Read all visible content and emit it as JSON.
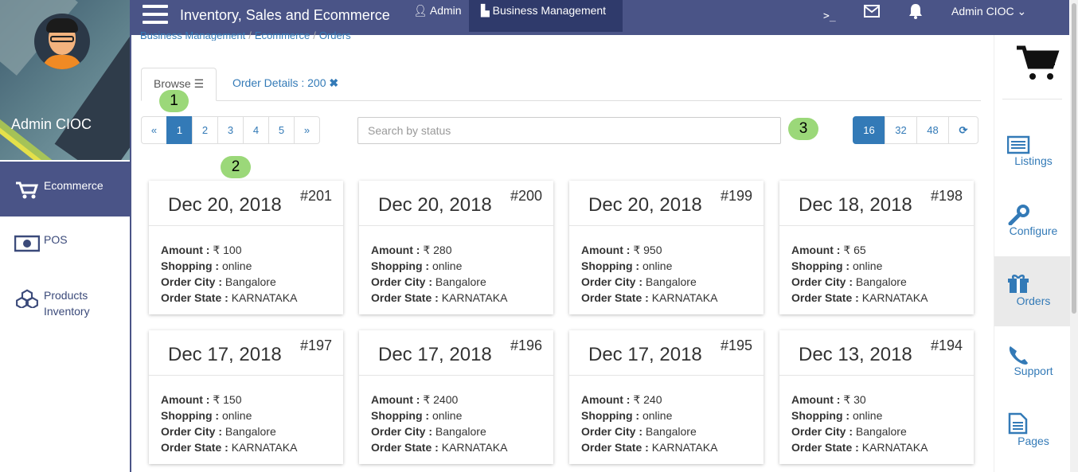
{
  "app": {
    "title": "Inventory, Sales and Ecommerce"
  },
  "topnav": {
    "admin_label": "Admin",
    "business_label": "Business Management",
    "terminal": ">_",
    "user_label": "Admin CIOC"
  },
  "profile": {
    "name": "Admin CIOC"
  },
  "sidebar": {
    "items": [
      {
        "label": "Ecommerce",
        "icon": "cart-icon",
        "active": true
      },
      {
        "label": "POS",
        "icon": "money-icon",
        "active": false
      },
      {
        "label": "Products Inventory",
        "icon": "cubes-icon",
        "active": false
      }
    ]
  },
  "breadcrumb": [
    "Business Management",
    "Ecommerce",
    "Orders"
  ],
  "tabs": {
    "browse_label": "Browse",
    "order_details_label": "Order Details : 200"
  },
  "annotations": [
    "1",
    "2",
    "3"
  ],
  "pagination": {
    "prev": "«",
    "pages": [
      "1",
      "2",
      "3",
      "4",
      "5"
    ],
    "next": "»",
    "active": "1"
  },
  "search": {
    "placeholder": "Search by status",
    "value": ""
  },
  "page_size": {
    "options": [
      "16",
      "32",
      "48"
    ],
    "active": "16"
  },
  "labels": {
    "amount": "Amount :",
    "shopping": "Shopping :",
    "city": "Order City :",
    "state": "Order State :",
    "currency": "₹"
  },
  "orders": [
    {
      "date": "Dec 20, 2018",
      "number": "#201",
      "amount": "100",
      "shopping": "online",
      "city": "Bangalore",
      "state": "KARNATAKA"
    },
    {
      "date": "Dec 20, 2018",
      "number": "#200",
      "amount": "280",
      "shopping": "online",
      "city": "Bangalore",
      "state": "KARNATAKA"
    },
    {
      "date": "Dec 20, 2018",
      "number": "#199",
      "amount": "950",
      "shopping": "online",
      "city": "Bangalore",
      "state": "KARNATAKA"
    },
    {
      "date": "Dec 18, 2018",
      "number": "#198",
      "amount": "65",
      "shopping": "online",
      "city": "Bangalore",
      "state": "KARNATAKA"
    },
    {
      "date": "Dec 17, 2018",
      "number": "#197",
      "amount": "150",
      "shopping": "online",
      "city": "Bangalore",
      "state": "KARNATAKA"
    },
    {
      "date": "Dec 17, 2018",
      "number": "#196",
      "amount": "2400",
      "shopping": "online",
      "city": "Bangalore",
      "state": "KARNATAKA"
    },
    {
      "date": "Dec 17, 2018",
      "number": "#195",
      "amount": "240",
      "shopping": "online",
      "city": "Bangalore",
      "state": "KARNATAKA"
    },
    {
      "date": "Dec 13, 2018",
      "number": "#194",
      "amount": "30",
      "shopping": "online",
      "city": "Bangalore",
      "state": "KARNATAKA"
    }
  ],
  "right_sidebar": {
    "items": [
      {
        "label": "Listings",
        "icon": "list-icon",
        "active": false
      },
      {
        "label": "Configure",
        "icon": "wrench-icon",
        "active": false
      },
      {
        "label": "Orders",
        "icon": "gift-icon",
        "active": true
      },
      {
        "label": "Support",
        "icon": "phone-icon",
        "active": false
      },
      {
        "label": "Pages",
        "icon": "file-icon",
        "active": false
      }
    ]
  },
  "colors": {
    "navbar": "#4a5487",
    "accent": "#337ab7",
    "annotation": "#9bd879"
  }
}
